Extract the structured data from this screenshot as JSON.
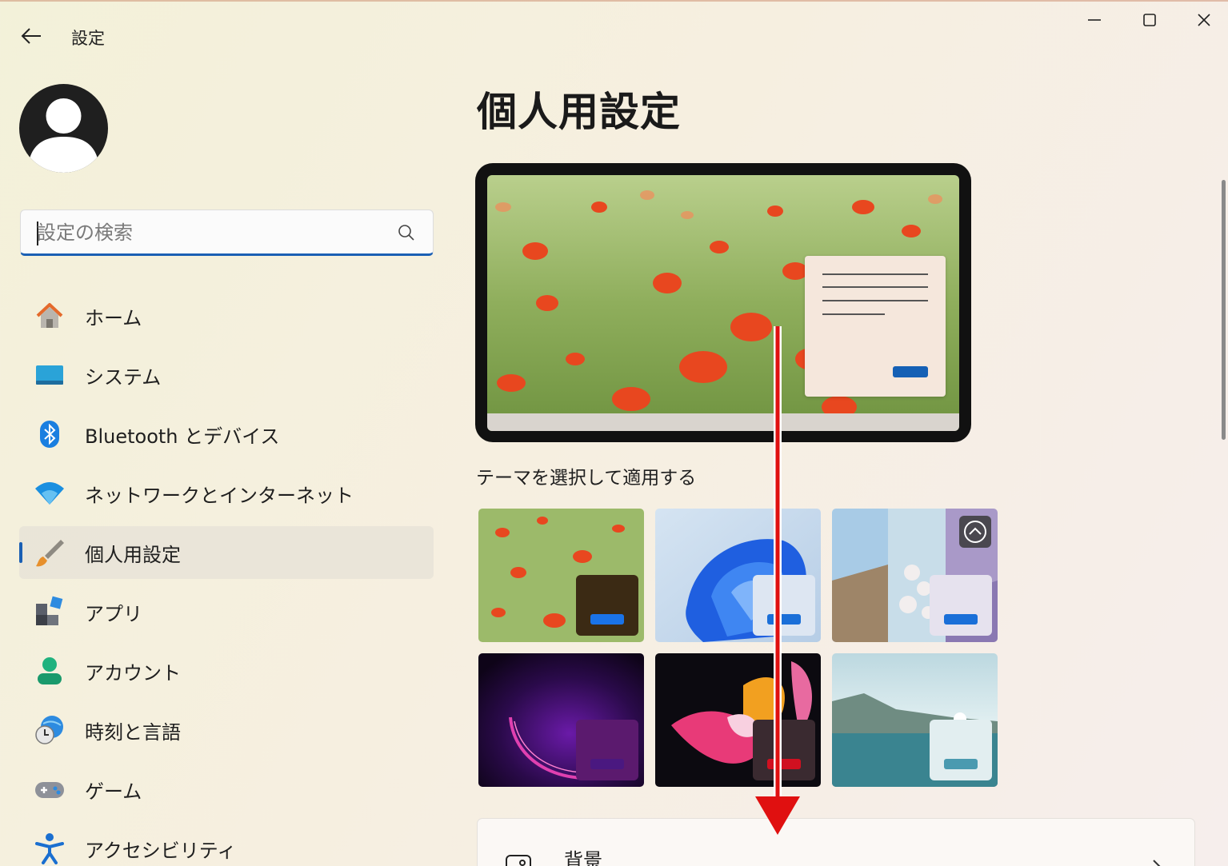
{
  "titlebar": {
    "app_title": "設定",
    "back_icon": "arrow-left-icon",
    "minimize_icon": "minimize-icon",
    "maximize_icon": "maximize-icon",
    "close_icon": "close-icon"
  },
  "sidebar": {
    "search": {
      "placeholder": "設定の検索",
      "value": ""
    },
    "items": [
      {
        "label": "ホーム",
        "icon": "home-icon"
      },
      {
        "label": "システム",
        "icon": "system-display-icon"
      },
      {
        "label": "Bluetooth とデバイス",
        "icon": "bluetooth-icon"
      },
      {
        "label": "ネットワークとインターネット",
        "icon": "wifi-icon"
      },
      {
        "label": "個人用設定",
        "icon": "paintbrush-icon",
        "active": true
      },
      {
        "label": "アプリ",
        "icon": "apps-icon"
      },
      {
        "label": "アカウント",
        "icon": "account-icon"
      },
      {
        "label": "時刻と言語",
        "icon": "globe-clock-icon"
      },
      {
        "label": "ゲーム",
        "icon": "gamepad-icon"
      },
      {
        "label": "アクセシビリティ",
        "icon": "accessibility-icon"
      }
    ]
  },
  "main": {
    "page_title": "個人用設定",
    "theme_section_label": "テーマを選択して適用する",
    "themes": [
      {
        "name": "poppies",
        "accent": "#1a73e8",
        "mini": "#3b2a14"
      },
      {
        "name": "bloom-light",
        "accent": "#1a6fd8",
        "mini": "#dde6f2"
      },
      {
        "name": "captured-motion",
        "accent": "#1a6fd8",
        "mini": "#e6e2ee",
        "slideshow_icon": "slideshow-icon"
      },
      {
        "name": "glow",
        "accent": "#4a1880",
        "mini": "#5b1a6e"
      },
      {
        "name": "flow",
        "accent": "#d01020",
        "mini": "#3a2a30"
      },
      {
        "name": "sunrise",
        "accent": "#4a9ab0",
        "mini": "#e2eef0"
      }
    ],
    "cards": [
      {
        "label": "背景",
        "icon": "background-image-icon"
      }
    ]
  },
  "colors": {
    "accent": "#1a5fb4",
    "annotation_arrow": "#e01010"
  }
}
